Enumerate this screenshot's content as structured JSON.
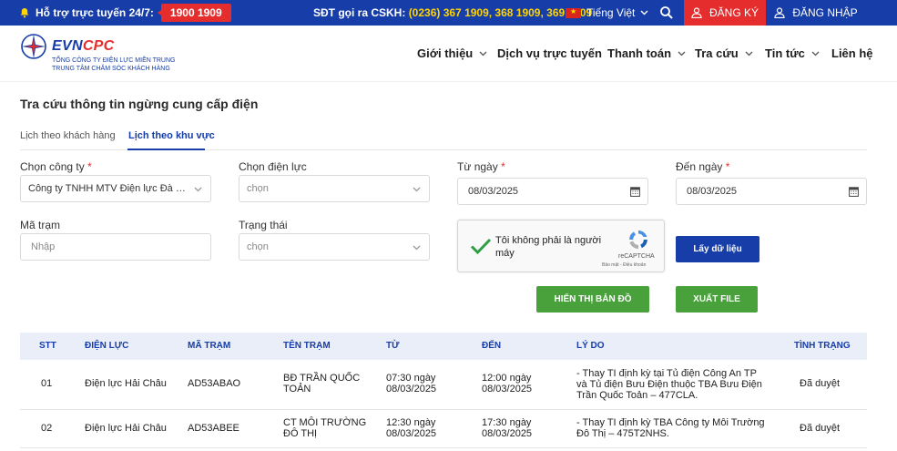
{
  "topbar": {
    "hotline_label": "Hỗ trợ trực tuyến 24/7:",
    "hotline_number": "1900 1909",
    "cskh_label": "SĐT gọi ra CSKH:",
    "cskh_phones": "(0236) 367 1909, 368 1909, 369 1909",
    "language": "Tiếng Việt",
    "register": "ĐĂNG KÝ",
    "login": "ĐĂNG NHẬP"
  },
  "logo": {
    "brand_evn": "EVN",
    "brand_cpc": "CPC",
    "sub1": "TỔNG CÔNG TY ĐIỆN LỰC MIỀN TRUNG",
    "sub2": "TRUNG TÂM CHĂM SÓC KHÁCH HÀNG"
  },
  "nav": [
    "Giới thiệu",
    "Dịch vụ trực tuyến",
    "Thanh toán",
    "Tra cứu",
    "Tin tức",
    "Liên hệ"
  ],
  "page": {
    "title": "Tra cứu thông tin ngừng cung cấp điện",
    "tabs": [
      "Lịch theo khách hàng",
      "Lịch theo khu vực"
    ]
  },
  "form": {
    "company_label": "Chọn công ty",
    "company_value": "Công ty TNHH MTV Điện lực Đà Nẵ...",
    "district_label": "Chọn điện lực",
    "district_placeholder": "chọn",
    "from_label": "Từ ngày",
    "from_value": "08/03/2025",
    "to_label": "Đến ngày",
    "to_value": "08/03/2025",
    "station_label": "Mã trạm",
    "station_placeholder": "Nhập",
    "status_label": "Trạng thái",
    "status_placeholder": "chọn",
    "required_mark": "*"
  },
  "captcha": {
    "text": "Tôi không phải là người máy",
    "brand": "reCAPTCHA",
    "terms": "Bảo mật - Điều khoản"
  },
  "buttons": {
    "get_data": "Lấy dữ liệu",
    "show_map": "HIỂN THỊ BẢN ĐỒ",
    "export": "XUẤT FILE"
  },
  "table": {
    "headers": [
      "STT",
      "ĐIỆN LỰC",
      "MÃ TRẠM",
      "TÊN TRẠM",
      "TỪ",
      "ĐẾN",
      "LÝ DO",
      "TÌNH TRẠNG"
    ],
    "rows": [
      {
        "stt": "01",
        "dien_luc": "Điện lực Hải Châu",
        "ma_tram": "AD53ABAO",
        "ten_tram_1": "BĐ TRẦN QUỐC",
        "ten_tram_2": "TOẢN",
        "tu_1": "07:30 ngày",
        "tu_2": "08/03/2025",
        "den_1": "12:00 ngày",
        "den_2": "08/03/2025",
        "ly_do_1": "- Thay TI định kỳ tại Tủ điện Công An TP",
        "ly_do_2": "và Tủ điện Bưu Điện thuộc TBA Bưu Điện",
        "ly_do_3": "Trần Quốc Toản – 477CLA.",
        "tinh_trang": "Đã duyệt"
      },
      {
        "stt": "02",
        "dien_luc": "Điện lực Hải Châu",
        "ma_tram": "AD53ABEE",
        "ten_tram_1": "CT MÔI TRƯỜNG",
        "ten_tram_2": "ĐÔ THỊ",
        "tu_1": "12:30 ngày",
        "tu_2": "08/03/2025",
        "den_1": "17:30 ngày",
        "den_2": "08/03/2025",
        "ly_do_1": "- Thay TI định kỳ TBA Công ty Môi Trường",
        "ly_do_2": "Đô Thị – 475T2NHS.",
        "ly_do_3": "",
        "tinh_trang": "Đã duyệt"
      }
    ]
  },
  "colors": {
    "primary": "#163da8",
    "accent_red": "#e52d2d",
    "green": "#48a13b",
    "yellow": "#ffd400"
  }
}
